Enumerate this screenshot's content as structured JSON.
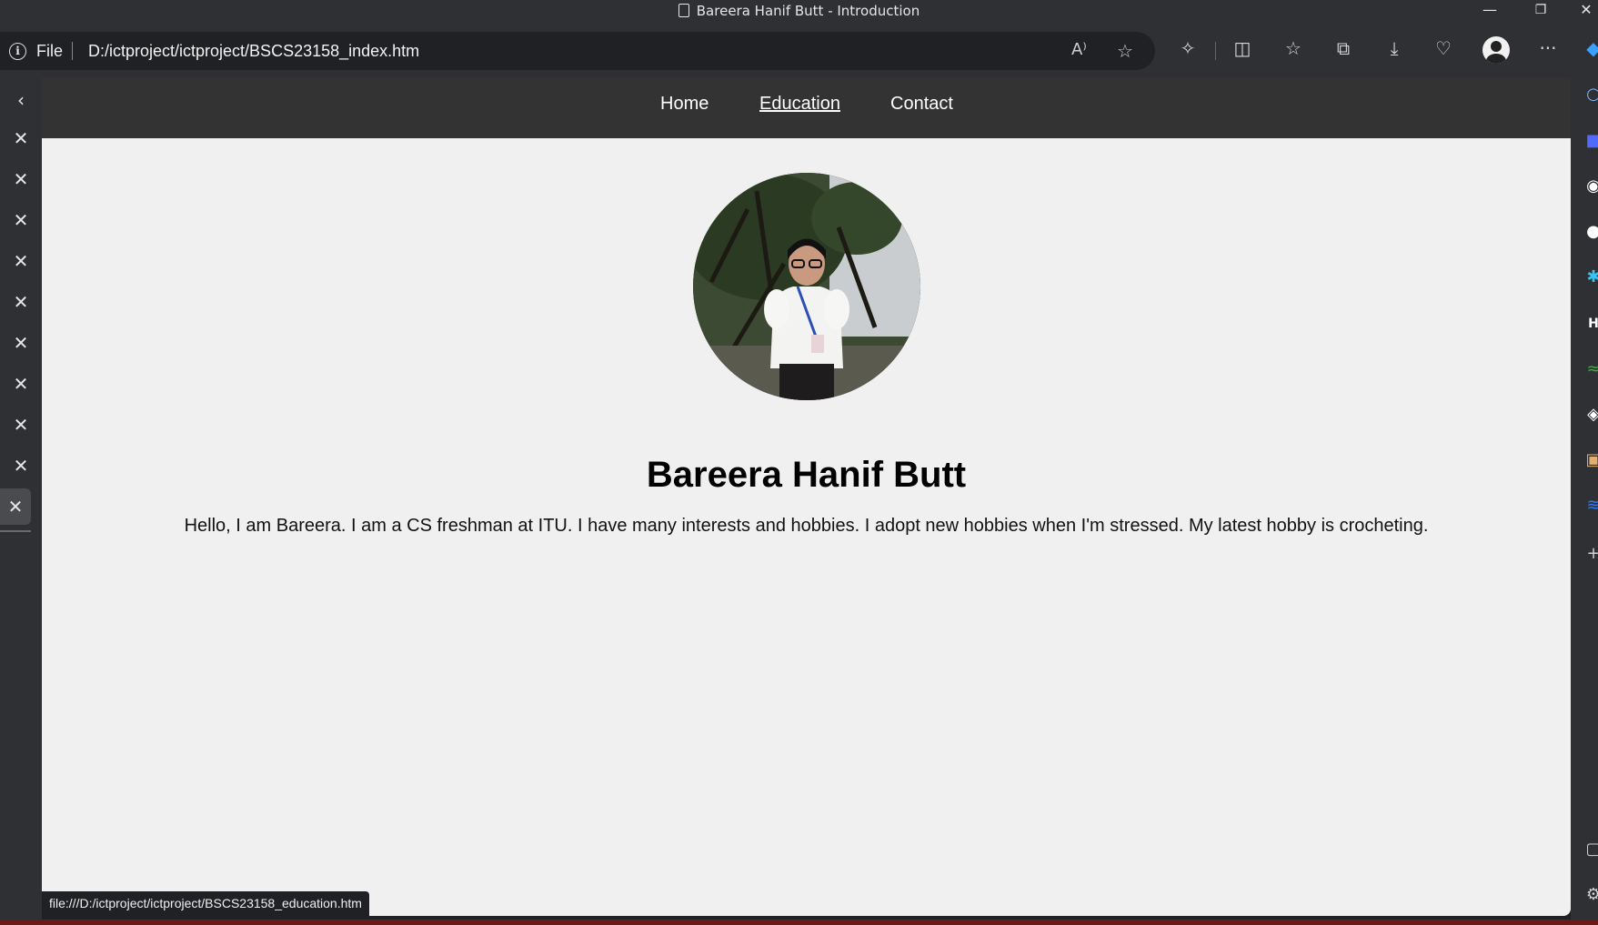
{
  "window": {
    "title": "Bareera Hanif Butt - Introduction",
    "controls": {
      "minimize": "—",
      "restore": "❐",
      "close": "✕"
    }
  },
  "address_bar": {
    "scheme_label": "File",
    "url": "D:/ictproject/ictproject/BSCS23158_index.htm",
    "icons": [
      "info-icon",
      "read-aloud-icon",
      "favorite-star-icon"
    ]
  },
  "toolbar_icons": [
    "extensions-icon",
    "split-screen-icon",
    "favorites-icon",
    "collections-icon",
    "downloads-icon",
    "browser-essentials-icon",
    "profile-avatar",
    "more-menu-icon",
    "copilot-icon"
  ],
  "vertical_tabs": {
    "collapse_icon": "chevron-left-icon",
    "tabs": [
      {
        "close": "✕"
      },
      {
        "close": "✕"
      },
      {
        "close": "✕"
      },
      {
        "close": "✕"
      },
      {
        "close": "✕"
      },
      {
        "close": "✕"
      },
      {
        "close": "✕"
      },
      {
        "close": "✕"
      },
      {
        "close": "✕"
      },
      {
        "close": "✕",
        "active": true
      }
    ]
  },
  "page": {
    "nav": {
      "home": "Home",
      "education": "Education",
      "contact": "Contact"
    },
    "profile_photo": "profile-photo",
    "name": "Bareera Hanif Butt",
    "intro": "Hello, I am Bareera. I am a CS freshman at ITU. I have many interests and hobbies. I adopt new hobbies when I'm stressed. My latest hobby is crocheting."
  },
  "status_bar": {
    "link_preview": "file:///D:/ictproject/ictproject/BSCS23158_education.htm"
  },
  "colors": {
    "nav_bg": "#333333",
    "page_bg": "#f0f0f0",
    "browser_chrome": "#2f3033"
  }
}
